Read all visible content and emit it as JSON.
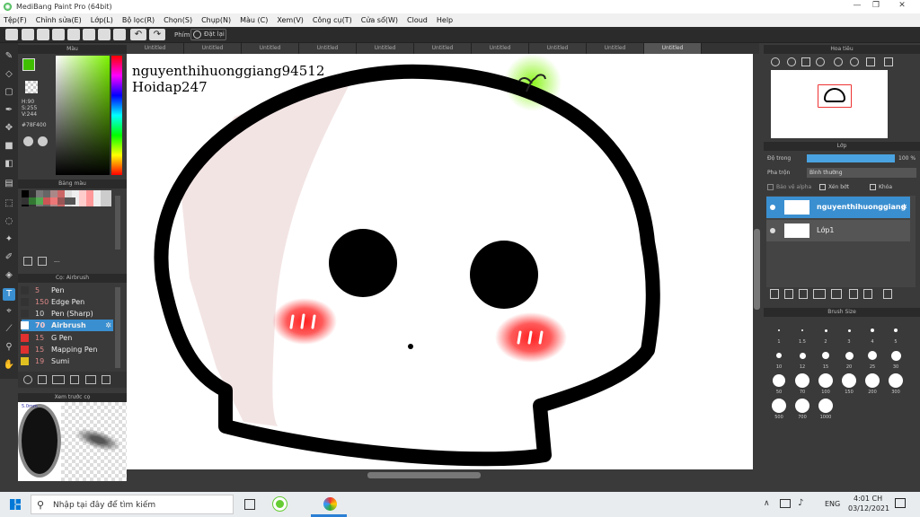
{
  "window": {
    "title": "MediBang Paint Pro (64bit)",
    "minimize": "—",
    "restore": "❐",
    "close": "✕"
  },
  "menu": [
    "Tệp(F)",
    "Chỉnh sửa(E)",
    "Lớp(L)",
    "Bộ lọc(R)",
    "Chọn(S)",
    "Chụp(N)",
    "Màu (C)",
    "Xem(V)",
    "Công cụ(T)",
    "Cửa sổ(W)",
    "Cloud",
    "Help"
  ],
  "toolbar": {
    "shortcut_label": "Phím",
    "reset_label": "Đặt lại"
  },
  "tabs": [
    "Untitled",
    "Untitled",
    "Untitled",
    "Untitled",
    "Untitled",
    "Untitled",
    "Untitled",
    "Untitled",
    "Untitled",
    "Untitled"
  ],
  "color_panel": {
    "title": "Màu",
    "h": "H:90",
    "s": "S:255",
    "v": "V:244",
    "hex": "#78F400",
    "fg_color": "#3fbf00"
  },
  "palette": {
    "title": "Bảng màu",
    "add_label": "---"
  },
  "brush_panel": {
    "title": "Cọ: Airbrush",
    "items": [
      {
        "size": "5",
        "name": "Pen",
        "color": "#333333"
      },
      {
        "size": "150",
        "name": "Edge Pen",
        "color": "#333333"
      },
      {
        "size": "10",
        "name": "Pen (Sharp)",
        "color": "#333333"
      },
      {
        "size": "70",
        "name": "Airbrush",
        "color": "#e03030"
      },
      {
        "size": "15",
        "name": "G Pen",
        "color": "#e03030"
      },
      {
        "size": "15",
        "name": "Mapping Pen",
        "color": "#e03030"
      },
      {
        "size": "19",
        "name": "Sumi",
        "color": "#e0c020"
      }
    ]
  },
  "preview_panel": {
    "title": "Xem trước cọ",
    "size_label": "5.0mm"
  },
  "canvas": {
    "text_line1": "nguyenthihuonggiang94512",
    "text_line2": "Hoidap247"
  },
  "navigator": {
    "title": "Hoa tiêu"
  },
  "layer_panel": {
    "title": "Lớp",
    "opacity_label": "Độ trong",
    "opacity_value": "100 %",
    "blend_label": "Pha trộn",
    "blend_value": "Bình thường",
    "protect_alpha": "Bảo vệ alpha",
    "clipping": "Xén bớt",
    "lock": "Khóa",
    "layers": [
      {
        "name": "nguyenthihuonggiang"
      },
      {
        "name": "Lớp1"
      }
    ]
  },
  "brush_size": {
    "title": "Brush Size",
    "sizes": [
      "1",
      "1.5",
      "2",
      "3",
      "4",
      "5",
      "10",
      "12",
      "15",
      "20",
      "25",
      "30",
      "50",
      "70",
      "100",
      "150",
      "200",
      "300",
      "500",
      "700",
      "1000"
    ]
  },
  "taskbar": {
    "search_placeholder": "Nhập tại đây để tìm kiếm",
    "lang": "ENG",
    "time": "4:01 CH",
    "date": "03/12/2021"
  }
}
